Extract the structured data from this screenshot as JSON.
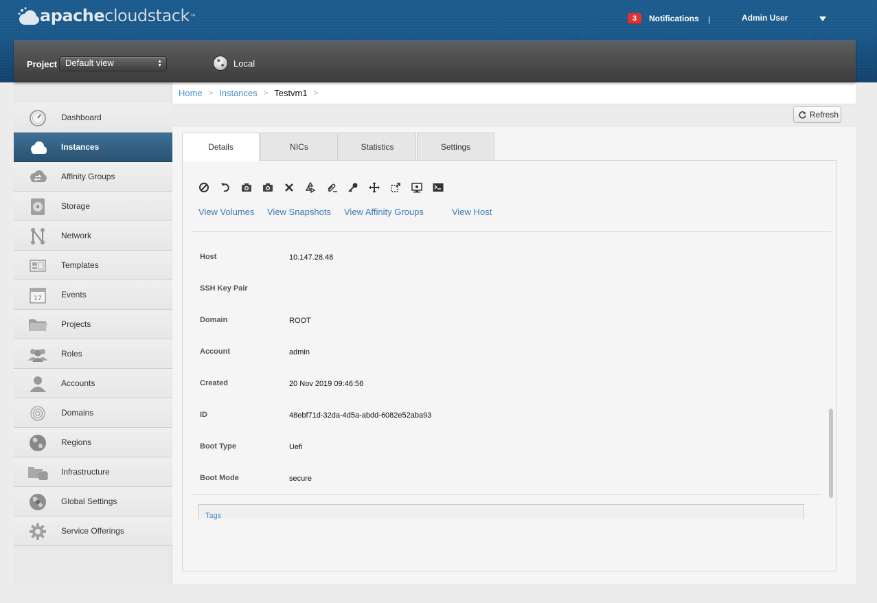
{
  "header": {
    "logo": {
      "bold": "apache",
      "light": "cloudstack",
      "tm": "™"
    },
    "notifications": {
      "count": "3",
      "label": "Notifications"
    },
    "separator": "|",
    "user": "Admin User"
  },
  "projectbar": {
    "project_label": "Project",
    "project_select": "Default view",
    "zone": "Local"
  },
  "sidebar": {
    "items": [
      {
        "label": "Dashboard",
        "icon": "dashboard-icon"
      },
      {
        "label": "Instances",
        "icon": "cloud-icon",
        "active": true
      },
      {
        "label": "Affinity Groups",
        "icon": "affinity-groups-icon"
      },
      {
        "label": "Storage",
        "icon": "storage-icon"
      },
      {
        "label": "Network",
        "icon": "network-icon"
      },
      {
        "label": "Templates",
        "icon": "templates-icon"
      },
      {
        "label": "Events",
        "icon": "calendar-icon"
      },
      {
        "label": "Projects",
        "icon": "folder-icon"
      },
      {
        "label": "Roles",
        "icon": "roles-icon"
      },
      {
        "label": "Accounts",
        "icon": "user-icon"
      },
      {
        "label": "Domains",
        "icon": "domains-icon"
      },
      {
        "label": "Regions",
        "icon": "globe-icon"
      },
      {
        "label": "Infrastructure",
        "icon": "infrastructure-icon"
      },
      {
        "label": "Global Settings",
        "icon": "global-settings-icon"
      },
      {
        "label": "Service Offerings",
        "icon": "gear-icon"
      }
    ],
    "events_day": "17"
  },
  "breadcrumb": {
    "home": "Home",
    "instances": "Instances",
    "current": "Testvm1",
    "sep": ">"
  },
  "toolbar": {
    "refresh": "Refresh"
  },
  "tabs": [
    "Details",
    "NICs",
    "Statistics",
    "Settings"
  ],
  "actions": [
    "stop-icon",
    "reboot-icon",
    "snapshot-icon",
    "vm-snapshot-icon",
    "destroy-icon",
    "reinstall-icon",
    "attach-iso-icon",
    "reset-password-icon",
    "migrate-icon",
    "scale-icon",
    "console-icon",
    "terminal-icon"
  ],
  "links": {
    "volumes": "View Volumes",
    "snapshots": "View Snapshots",
    "affinity": "View Affinity Groups",
    "host": "View Host"
  },
  "details": [
    {
      "label": "Host",
      "value": "10.147.28.48"
    },
    {
      "label": "SSH Key Pair",
      "value": ""
    },
    {
      "label": "Domain",
      "value": "ROOT"
    },
    {
      "label": "Account",
      "value": "admin"
    },
    {
      "label": "Created",
      "value": "20 Nov 2019 09:46:56"
    },
    {
      "label": "ID",
      "value": "48ebf71d-32da-4d5a-abdd-6082e52aba93"
    },
    {
      "label": "Boot Type",
      "value": "Uefi"
    },
    {
      "label": "Boot Mode",
      "value": "secure"
    }
  ],
  "tags_label": "Tags",
  "colors": {
    "accent": "#4a8fc9",
    "active_nav": "#2f5a7c",
    "badge": "#dd3333"
  }
}
